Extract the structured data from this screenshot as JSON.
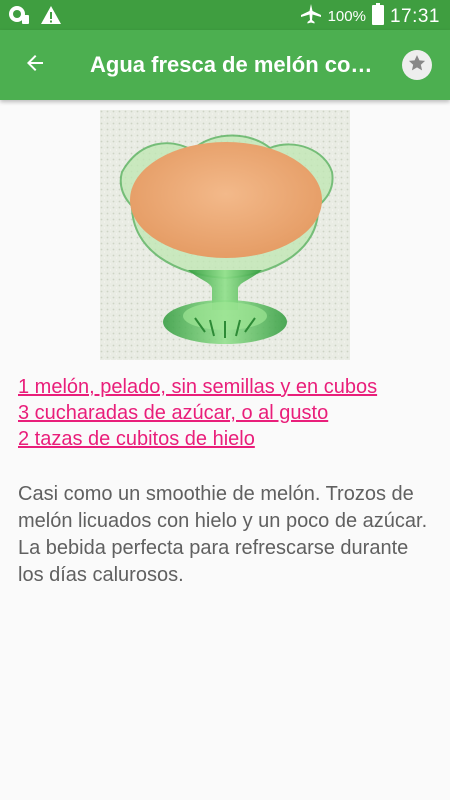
{
  "status_bar": {
    "battery_percent": "100%",
    "time": "17:31",
    "icons": [
      "notification-icon",
      "warning-icon",
      "airplane-mode-icon",
      "battery-icon"
    ]
  },
  "app_bar": {
    "title": "Agua fresca de melón con hielo",
    "back_icon": "arrow-back-icon",
    "favorite_icon": "star-icon"
  },
  "recipe": {
    "ingredients": [
      "1 melón, pelado, sin semillas y en cubos",
      "3 cucharadas de azúcar, o al gusto",
      "2 tazas de cubitos de hielo"
    ],
    "description": "Casi como un smoothie de melón. Trozos de melón licuados con hielo y un poco de azúcar. La bebida perfecta para refrescarse durante los días calurosos."
  },
  "colors": {
    "status_bar": "#3f9e40",
    "app_bar": "#4caf50",
    "link": "#e91e7a",
    "body_text": "#606060"
  }
}
